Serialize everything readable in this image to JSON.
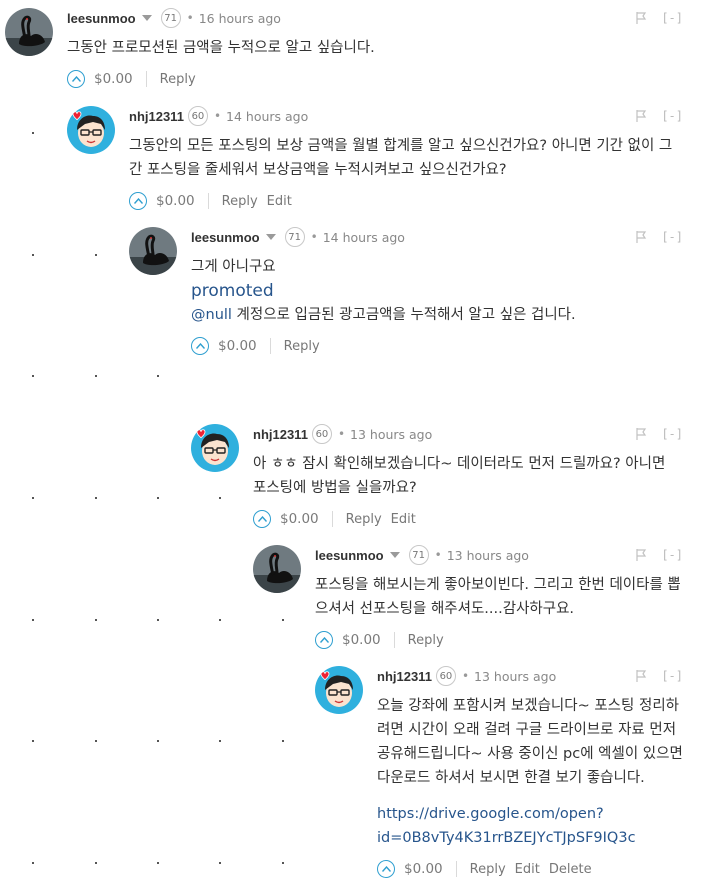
{
  "comments": [
    {
      "author": "leesunmoo",
      "rep": "71",
      "time": "16 hours ago",
      "text": [
        "그동안 프로모션된 금액을 누적으로 알고 싶습니다."
      ],
      "payout": "$0.00",
      "actions": [
        "Reply"
      ],
      "avatar": "black-swan"
    },
    {
      "author": "nhj12311",
      "rep": "60",
      "time": "14 hours ago",
      "text": [
        "그동안의 모든 포스팅의 보상 금액을 월별 합계를 알고 싶으신건가요? 아니면 기간 없이 그간 포스팅을 줄세워서 보상금액을 누적시켜보고 싶으신건가요?"
      ],
      "payout": "$0.00",
      "actions": [
        "Reply",
        "Edit"
      ],
      "avatar": "cartoon-boy"
    },
    {
      "author": "leesunmoo",
      "rep": "71",
      "time": "14 hours ago",
      "text": [
        "그게 아니구요"
      ],
      "promoted": "promoted",
      "mention": "@null",
      "mention_text": " 계정으로 입금된 광고금액을 누적해서 알고 싶은 겁니다.",
      "payout": "$0.00",
      "actions": [
        "Reply"
      ],
      "avatar": "black-swan"
    },
    {
      "author": "nhj12311",
      "rep": "60",
      "time": "13 hours ago",
      "text": [
        "아 ㅎㅎ 잠시 확인해보겠습니다~ 데이터라도 먼저 드릴까요? 아니면 포스팅에 방법을 실을까요?"
      ],
      "payout": "$0.00",
      "actions": [
        "Reply",
        "Edit"
      ],
      "avatar": "cartoon-boy"
    },
    {
      "author": "leesunmoo",
      "rep": "71",
      "time": "13 hours ago",
      "text": [
        "포스팅을 해보시는게 좋아보이빈다. 그리고 한번 데이타를 뽑으셔서 선포스팅을 해주셔도....감사하구요."
      ],
      "payout": "$0.00",
      "actions": [
        "Reply"
      ],
      "avatar": "black-swan"
    },
    {
      "author": "nhj12311",
      "rep": "60",
      "time": "13 hours ago",
      "text": [
        "오늘 강좌에 포함시켜 보겠습니다~ 포스팅 정리하려면 시간이 오래 걸려 구글 드라이브로 자료 먼저 공유해드립니다~ 사용 중이신 pc에 엑셀이 있으면 다운로드 하셔서 보시면 한결 보기 좋습니다."
      ],
      "link_line1": "https://drive.google.com/open?",
      "link_line2": "id=0B8vTy4K31rrBZEJYcTJpSF9IQ3c",
      "payout": "$0.00",
      "actions": [
        "Reply",
        "Edit",
        "Delete"
      ],
      "avatar": "cartoon-boy"
    }
  ],
  "collapse_label": "[-]",
  "colors": {
    "link": "#27558c",
    "upvote": "#2f9fd0",
    "avatar_bg": "#2fb0de"
  }
}
